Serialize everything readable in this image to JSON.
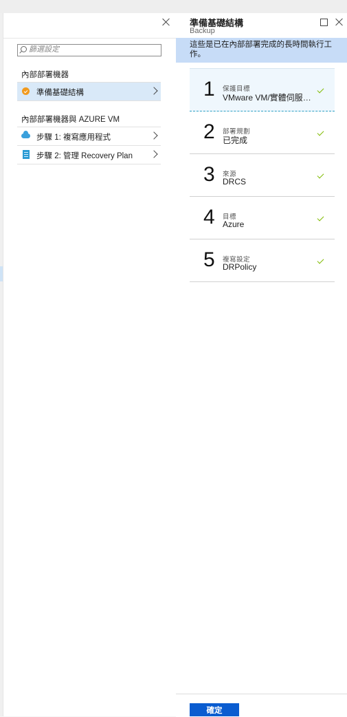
{
  "left_blade": {
    "filter_placeholder": "篩選設定",
    "section1": {
      "heading": "內部部署機器",
      "items": [
        {
          "label": "準備基礎結構",
          "icon": "orange-check-circle-icon",
          "selected": true
        }
      ]
    },
    "section2": {
      "heading": "內部部署機器與 AZURE VM",
      "items": [
        {
          "label": "步驟 1: 複寫應用程式",
          "icon": "cloud-icon"
        },
        {
          "label": "步驟 2: 管理 Recovery Plan",
          "icon": "book-icon"
        }
      ]
    }
  },
  "right_blade": {
    "title": "準備基礎結構",
    "subtitle": "Backup",
    "info_text": "這些是已在內部部署完成的長時間執行工作。",
    "steps": [
      {
        "number": "1",
        "caption": "保護目標",
        "value": "VMware VM/實體伺服器到 Azure",
        "status": "complete"
      },
      {
        "number": "2",
        "caption": "部署規劃",
        "value": "已完成",
        "status": "complete"
      },
      {
        "number": "3",
        "caption": "來源",
        "value": "DRCS",
        "status": "complete"
      },
      {
        "number": "4",
        "caption": "目標",
        "value": "Azure",
        "status": "complete"
      },
      {
        "number": "5",
        "caption": "複寫設定",
        "value": "DRPolicy",
        "status": "complete"
      }
    ],
    "ok_label": "確定"
  },
  "colors": {
    "accent": "#0a5cd0",
    "selected_bg": "#d9e9f8",
    "info_bg": "#c7dcf7",
    "check": "#7fba00",
    "orange": "#f19a1e"
  }
}
